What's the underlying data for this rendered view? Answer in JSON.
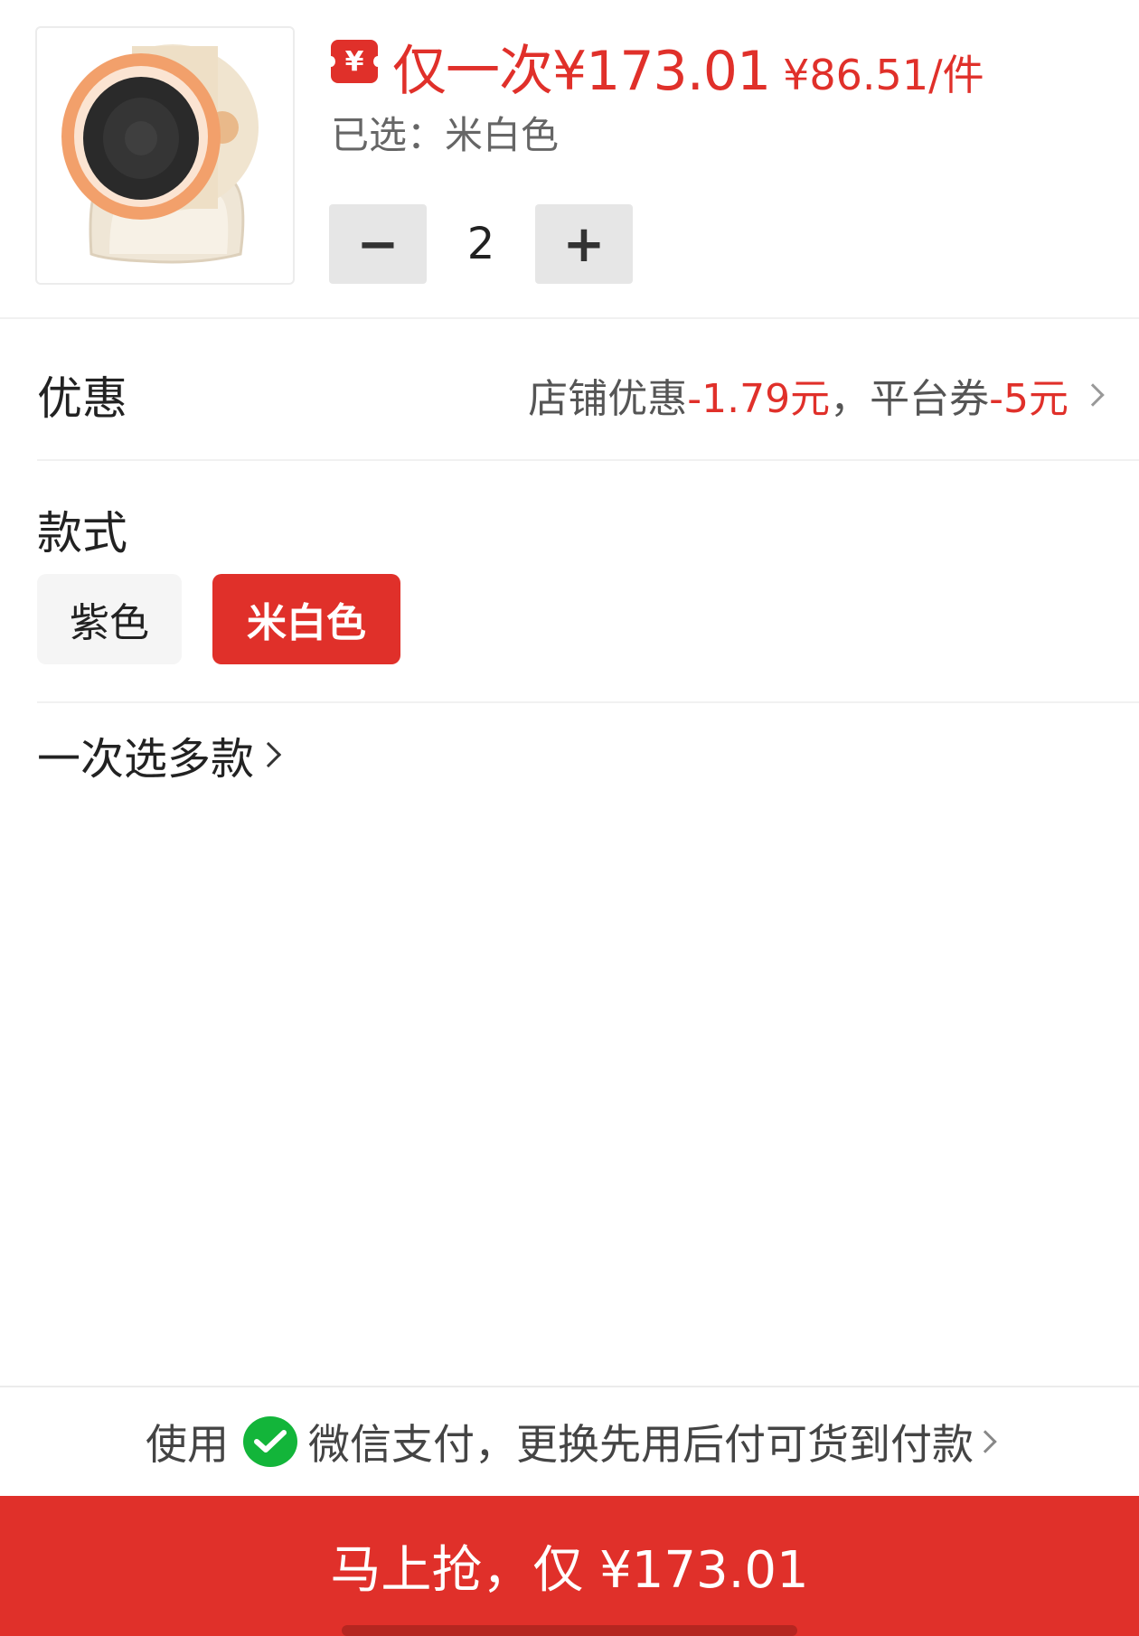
{
  "product": {
    "price_text": "仅一次¥173.01",
    "unit_price": "¥86.51/件",
    "selected_text": "已选：米白色",
    "quantity": "2",
    "coupon_symbol": "¥"
  },
  "stepper": {
    "minus": "−",
    "plus": "+"
  },
  "discount": {
    "label": "优惠",
    "store_label": "店铺优惠",
    "store_amount": "-1.79元",
    "separator": "，",
    "platform_label": "平台券",
    "platform_amount": "-5元"
  },
  "style": {
    "title": "款式",
    "options": [
      {
        "label": "紫色",
        "selected": false
      },
      {
        "label": "米白色",
        "selected": true
      }
    ]
  },
  "multi_select": {
    "label": "一次选多款"
  },
  "payment": {
    "prefix": "使用",
    "method": "微信支付，更换先用后付可货到付款"
  },
  "buy_button": {
    "label": "马上抢，仅 ¥173.01"
  },
  "colors": {
    "accent": "#e0302a",
    "wechat_green": "#13b53a"
  }
}
